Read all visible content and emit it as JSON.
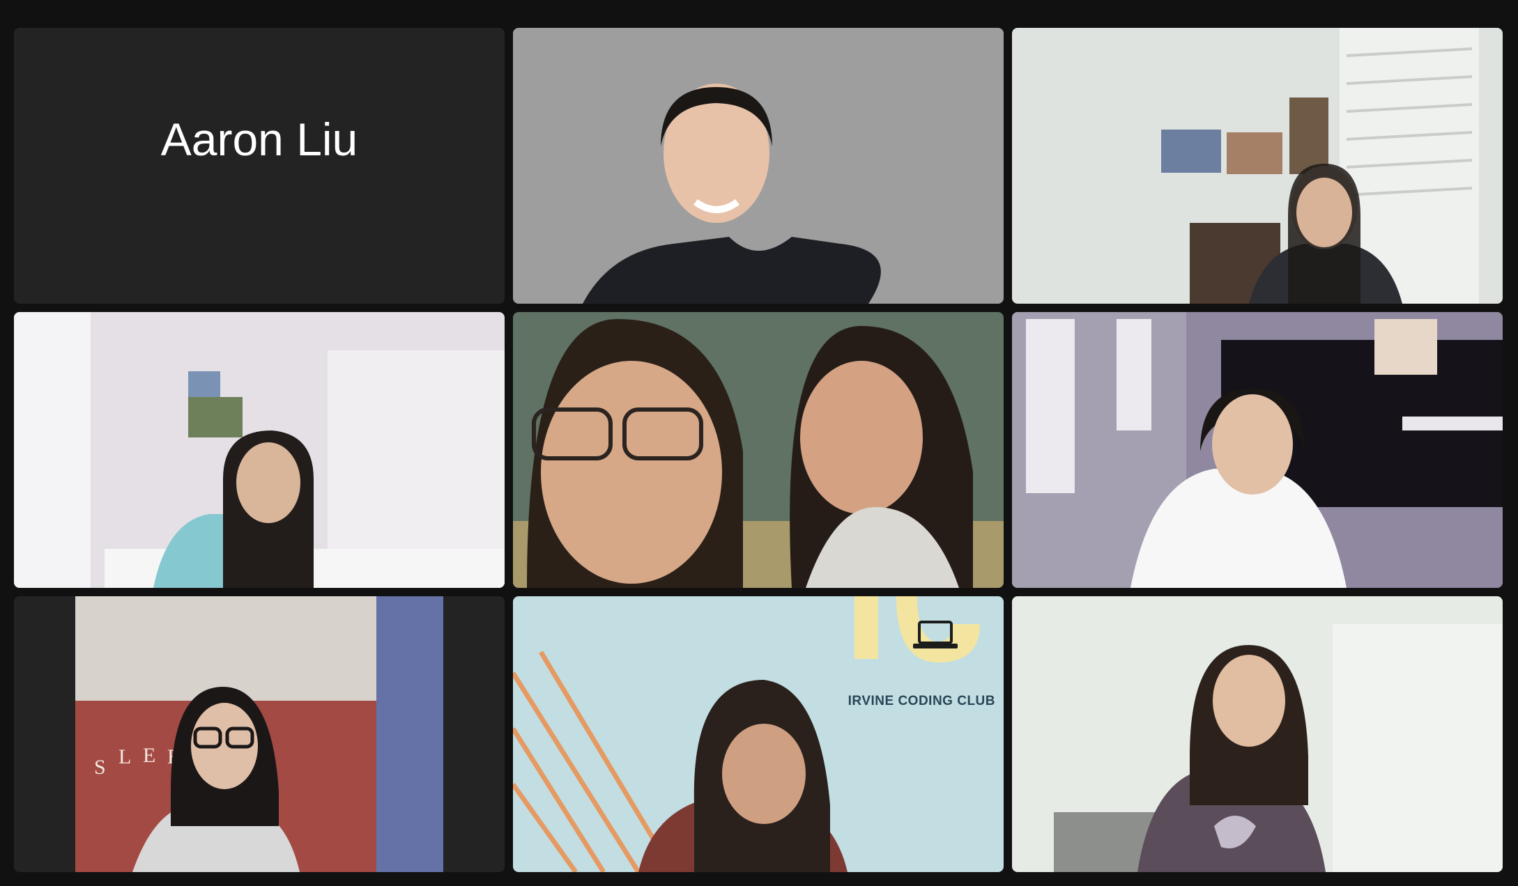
{
  "meeting": {
    "view": "gallery",
    "participants": [
      {
        "name": "Aaron Liu",
        "video": "off"
      },
      {
        "video": "on",
        "background": "gray backdrop"
      },
      {
        "video": "on",
        "background": "room with shutters and paintings"
      },
      {
        "video": "on",
        "background": "bedroom with shutters"
      },
      {
        "video": "on",
        "background": "green wall, two people"
      },
      {
        "video": "on",
        "background": "room with windows and piano",
        "active_speaker": true
      },
      {
        "video": "on",
        "background": "red wall with letters"
      },
      {
        "video": "on",
        "background": "Irvine Coding Club virtual background",
        "logo_text": "IRVINE CODING CLUB"
      },
      {
        "video": "on",
        "background": "white room"
      }
    ]
  },
  "colors": {
    "window_bg": "#111111",
    "tile_bg": "#232323",
    "active_speaker_border": "#61c85a",
    "name_text": "#ffffff"
  },
  "icons": [
    "laptop-icon"
  ]
}
